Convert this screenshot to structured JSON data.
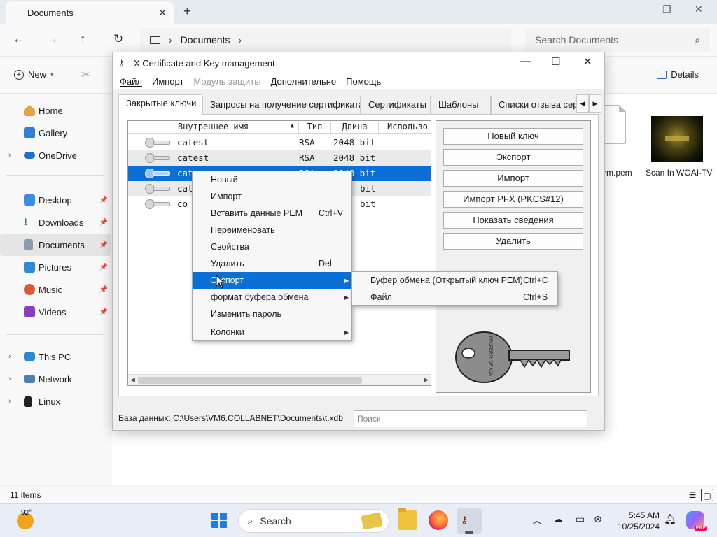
{
  "explorer": {
    "tab_title": "Documents",
    "breadcrumb": "Documents",
    "search_placeholder": "Search Documents",
    "toolbar": {
      "new_label": "New",
      "details_label": "Details"
    },
    "sidebar": {
      "home": "Home",
      "gallery": "Gallery",
      "onedrive": "OneDrive",
      "desktop": "Desktop",
      "downloads": "Downloads",
      "documents": "Documents",
      "pictures": "Pictures",
      "music": "Music",
      "videos": "Videos",
      "thispc": "This PC",
      "network": "Network",
      "linux": "Linux"
    },
    "files": {
      "pem_label": "rm.pem",
      "video_label": "Scan In WOAI-TV"
    },
    "status_count": "11 items"
  },
  "xca": {
    "title": "X Certificate and Key management",
    "menu": {
      "file": "Файл",
      "import": "Импорт",
      "modules": "Модуль защиты",
      "extra": "Дополнительно",
      "help": "Помощь"
    },
    "tabs": {
      "private_keys": "Закрытые ключи",
      "requests": "Запросы на получение сертификата",
      "certificates": "Сертификаты",
      "templates": "Шаблоны",
      "crl": "Списки отзыва сертис"
    },
    "columns": {
      "name": "Внутреннее имя",
      "type": "Тип",
      "length": "Длина",
      "usage": "Использо"
    },
    "rows": [
      {
        "name": "catest",
        "type": "RSA",
        "length": "2048 bit"
      },
      {
        "name": "catest",
        "type": "RSA",
        "length": "2048 bit"
      },
      {
        "name": "cat",
        "type": "RSA",
        "length": "2048 bit"
      },
      {
        "name": "cat",
        "type": "",
        "length": "bit"
      },
      {
        "name": "co",
        "type": "",
        "length": "bit"
      }
    ],
    "buttons": {
      "new_key": "Новый ключ",
      "export": "Экспорт",
      "import": "Импорт",
      "import_pfx": "Импорт PFX (PKCS#12)",
      "show_details": "Показать сведения",
      "delete": "Удалить"
    },
    "key_art_text": "PROPERTY OF XCA",
    "status_db": "База данных: C:\\Users\\VM6.COLLABNET\\Documents\\t.xdb",
    "search_placeholder": "Поиск"
  },
  "context_menu": {
    "new": "Новый",
    "import": "Импорт",
    "paste_pem": "Вставить данные PEM",
    "paste_pem_sc": "Ctrl+V",
    "rename": "Переименовать",
    "properties": "Свойства",
    "delete": "Удалить",
    "delete_sc": "Del",
    "export": "Экспорт",
    "clipboard_format": "формат буфера обмена",
    "change_password": "Изменить пароль",
    "columns": "Колонки"
  },
  "submenu": {
    "clipboard_pem": "Буфер обмена (Открытый ключ PEM)",
    "clipboard_pem_sc": "Ctrl+C",
    "file": "Файл",
    "file_sc": "Ctrl+S"
  },
  "taskbar": {
    "temperature": "92°",
    "search_label": "Search",
    "time": "5:45 AM",
    "date": "10/25/2024",
    "copilot_badge": "PRE"
  },
  "colors": {
    "selection": "#0a70d8",
    "start": "#1f7ae6",
    "folder": "#f3c23b"
  }
}
